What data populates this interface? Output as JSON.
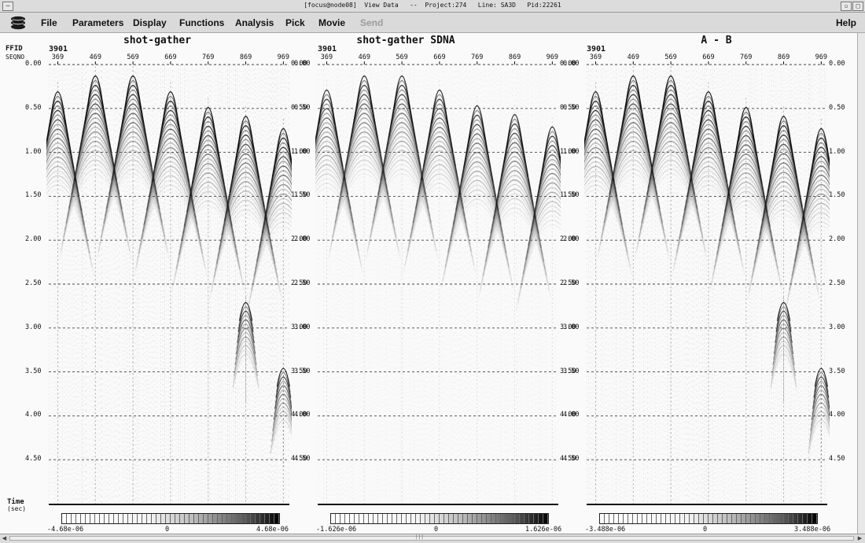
{
  "window": {
    "title": "[focus@node08]  View Data   --  Project:274   Line: SA3D   Pid:22261"
  },
  "menu": {
    "logo": "focus-logo-icon",
    "items": [
      {
        "label": "File",
        "enabled": true
      },
      {
        "label": "Parameters",
        "enabled": true
      },
      {
        "label": "Display",
        "enabled": true
      },
      {
        "label": "Functions",
        "enabled": true
      },
      {
        "label": "Analysis",
        "enabled": true
      },
      {
        "label": "Pick",
        "enabled": true
      },
      {
        "label": "Movie",
        "enabled": true
      },
      {
        "label": "Send",
        "enabled": false
      }
    ],
    "help": "Help"
  },
  "axis_labels": {
    "ffid": "FFID",
    "seqno": "SEQNO",
    "time": "Time",
    "time_unit": "(sec)"
  },
  "panels": [
    {
      "title": "shot-gather",
      "ffid": "3901",
      "seqno_ticks": [
        "369",
        "469",
        "569",
        "669",
        "769",
        "869",
        "969"
      ],
      "time_ticks": [
        "0.00",
        "0.50",
        "1.00",
        "1.50",
        "2.00",
        "2.50",
        "3.00",
        "3.50",
        "4.00",
        "4.50"
      ],
      "colorbar": {
        "min": "-4.68e-06",
        "mid": "0",
        "max": "4.68e-06"
      }
    },
    {
      "title": "shot-gather SDNA",
      "ffid": "3901",
      "seqno_ticks": [
        "369",
        "469",
        "569",
        "669",
        "769",
        "869",
        "969"
      ],
      "time_ticks": [
        "0.00",
        "0.50",
        "1.00",
        "1.50",
        "2.00",
        "2.50",
        "3.00",
        "3.50",
        "4.00",
        "4.50"
      ],
      "colorbar": {
        "min": "-1.626e-06",
        "mid": "0",
        "max": "1.626e-06"
      }
    },
    {
      "title": "A - B",
      "ffid": "3901",
      "seqno_ticks": [
        "369",
        "469",
        "569",
        "669",
        "769",
        "869",
        "969"
      ],
      "time_ticks": [
        "0.00",
        "0.50",
        "1.00",
        "1.50",
        "2.00",
        "2.50",
        "3.00",
        "3.50",
        "4.00",
        "4.50"
      ],
      "colorbar": {
        "min": "-3.488e-06",
        "mid": "0",
        "max": "3.488e-06"
      }
    }
  ],
  "colors": {
    "background": "#fafafa",
    "menubar": "#dadada",
    "ink": "#111111",
    "gridline": "#555555"
  }
}
